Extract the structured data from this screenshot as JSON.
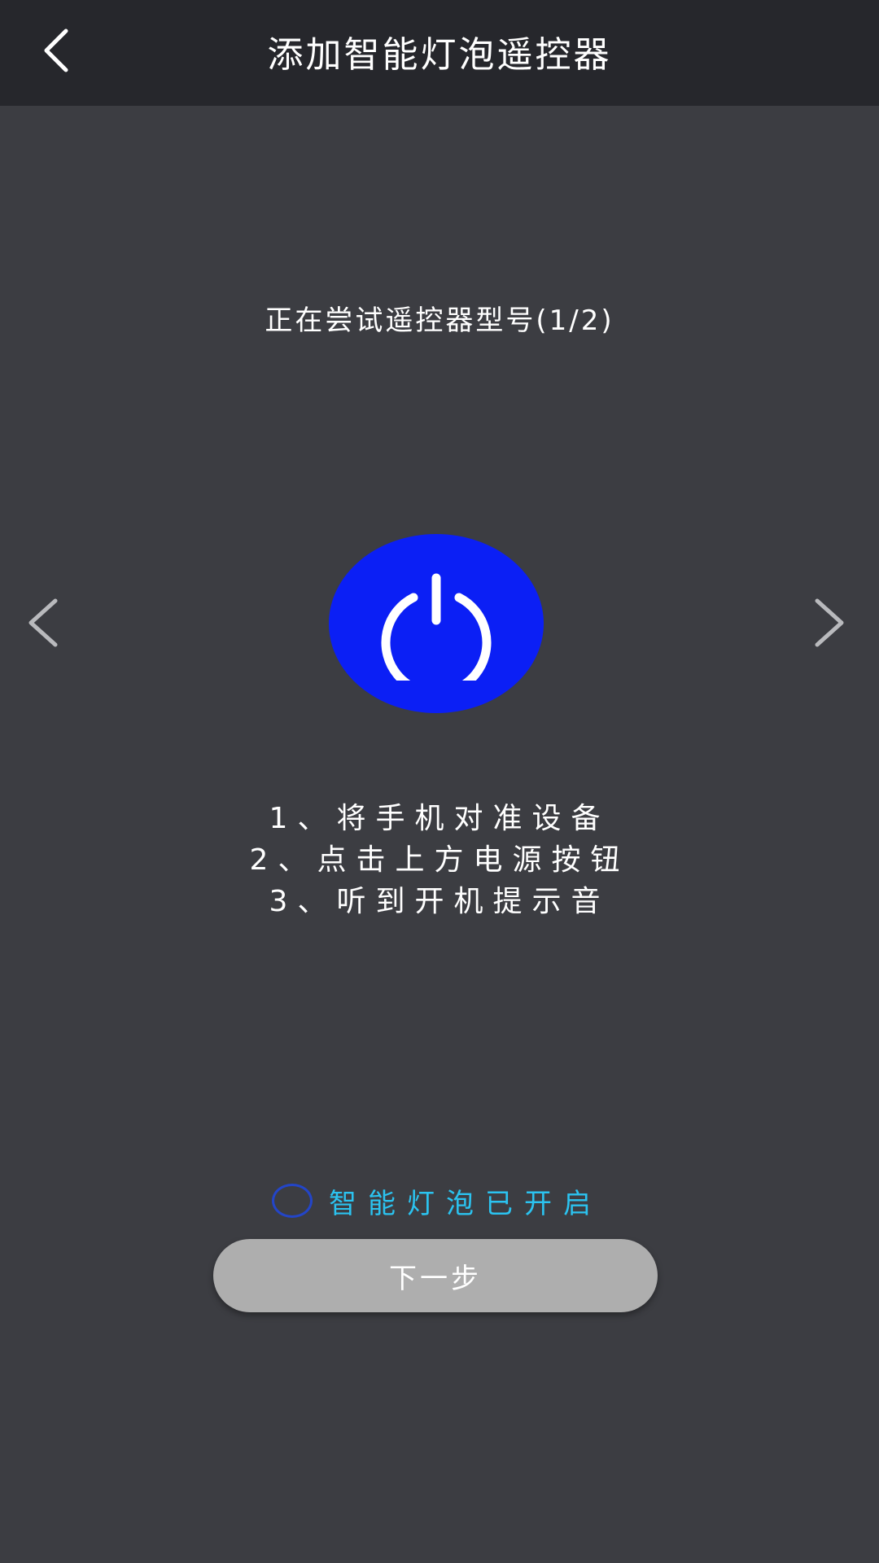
{
  "header": {
    "title": "添加智能灯泡遥控器",
    "back_icon": "chevron-left-icon"
  },
  "status": {
    "text": "正在尝试遥控器型号(1/2)"
  },
  "carousel": {
    "prev_icon": "chevron-left-icon",
    "next_icon": "chevron-right-icon"
  },
  "power": {
    "icon": "power-icon",
    "color": "#0b1ff5"
  },
  "instructions": [
    "1、将手机对准设备",
    "2、点击上方电源按钮",
    "3、听到开机提示音"
  ],
  "confirm": {
    "label": "智能灯泡已开启",
    "checked": false,
    "color": "#2bc3f0"
  },
  "next_button": {
    "label": "下一步"
  },
  "colors": {
    "header_bg": "#26272c",
    "page_bg": "#3c3d42",
    "button_bg": "#aeaeae"
  }
}
